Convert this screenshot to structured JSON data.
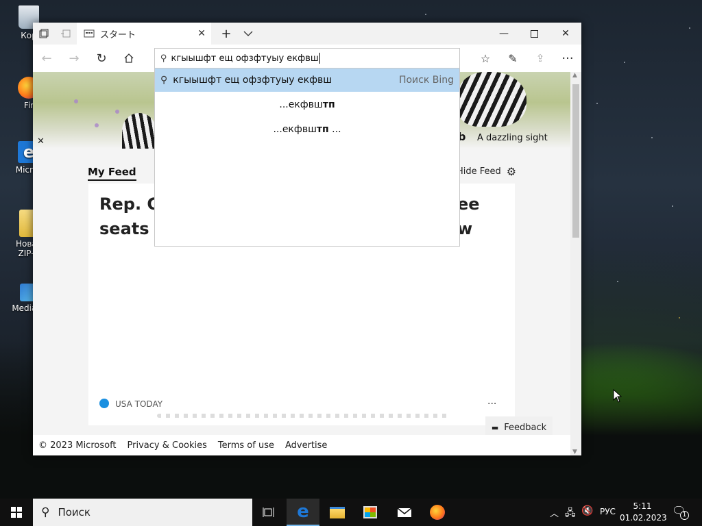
{
  "desktop": {
    "icons": [
      {
        "label": "Кор"
      },
      {
        "label": "Fir"
      },
      {
        "label": "Micros"
      },
      {
        "label": "Новая ZIP-п"
      },
      {
        "label": "MediaCr"
      }
    ]
  },
  "browser": {
    "tab_title": "スタート",
    "address_value": "кгыышфт ещ офзфтуыу екфвш",
    "suggestions": [
      {
        "text": "кгыышфт ещ офзфтуыу екфвш",
        "source": "Поиск Bing"
      },
      {
        "prefix": "...екфвш",
        "bold": "тп",
        "suffix": ""
      },
      {
        "prefix": "...екфвш",
        "bold": "тп",
        "suffix": " ..."
      }
    ]
  },
  "page": {
    "hero_caption": "A dazzling sight",
    "my_feed_label": "My Feed",
    "hide_feed_label": "Hide Feed",
    "headline_line1_start": "Rep. G",
    "headline_line1_end": "ee",
    "headline_line2_start": "seats a",
    "headline_line2_end": "w",
    "source_label": "USA TODAY",
    "more_label": "...",
    "feedback_label": "Feedback",
    "footer": {
      "copyright": "© 2023 Microsoft",
      "privacy": "Privacy & Cookies",
      "terms": "Terms of use",
      "advertise": "Advertise"
    }
  },
  "taskbar": {
    "search_placeholder": "Поиск",
    "lang": "РУС",
    "time": "5:11",
    "date": "01.02.2023",
    "notification_count": "1"
  },
  "colors": {
    "selection": "#b7d7f2",
    "taskbar_bg": "#101010",
    "edge_blue": "#1e78d7"
  }
}
